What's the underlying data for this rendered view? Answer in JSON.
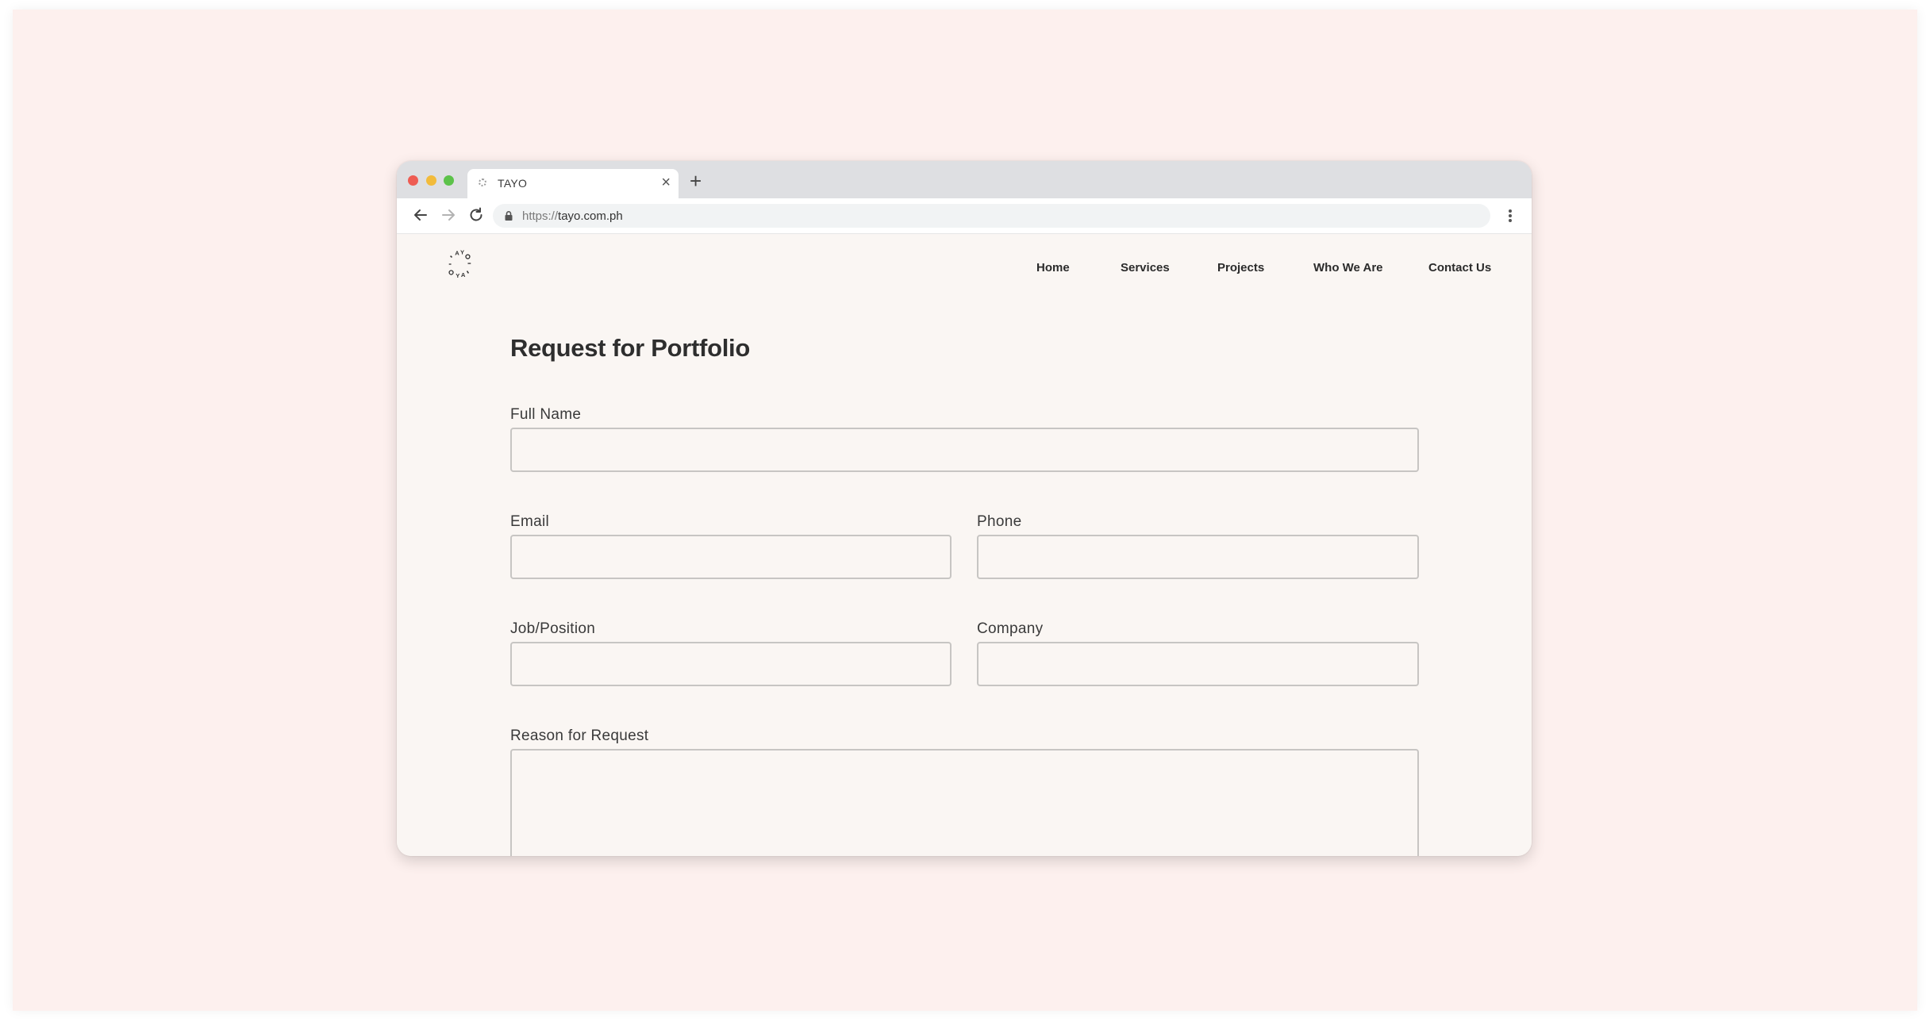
{
  "browser": {
    "tab": {
      "title": "TAYO"
    },
    "url": {
      "scheme": "https://",
      "host": "tayo.com.ph"
    }
  },
  "site": {
    "logo_text": "TAYO",
    "nav": [
      "Home",
      "Services",
      "Projects",
      "Who We Are",
      "Contact Us"
    ]
  },
  "form": {
    "title": "Request for Portfolio",
    "fields": {
      "full_name": {
        "label": "Full Name",
        "value": ""
      },
      "email": {
        "label": "Email",
        "value": ""
      },
      "phone": {
        "label": "Phone",
        "value": ""
      },
      "job_position": {
        "label": "Job/Position",
        "value": ""
      },
      "company": {
        "label": "Company",
        "value": ""
      },
      "reason": {
        "label": "Reason for Request",
        "value": ""
      }
    }
  },
  "colors": {
    "backdrop": "#fdf0ee",
    "page_background": "#faf6f3",
    "tab_bar": "#dedfe2",
    "close_light": "#ee5c53",
    "minimize_light": "#f2bb3b",
    "zoom_light": "#5cc24a",
    "input_border": "#c7c5c3"
  },
  "icons": {
    "back": "arrow-left-icon",
    "forward": "arrow-right-icon",
    "reload": "reload-icon",
    "lock": "lock-icon",
    "menu": "kebab-menu-icon",
    "new_tab": "plus-icon",
    "close_tab": "close-icon"
  }
}
